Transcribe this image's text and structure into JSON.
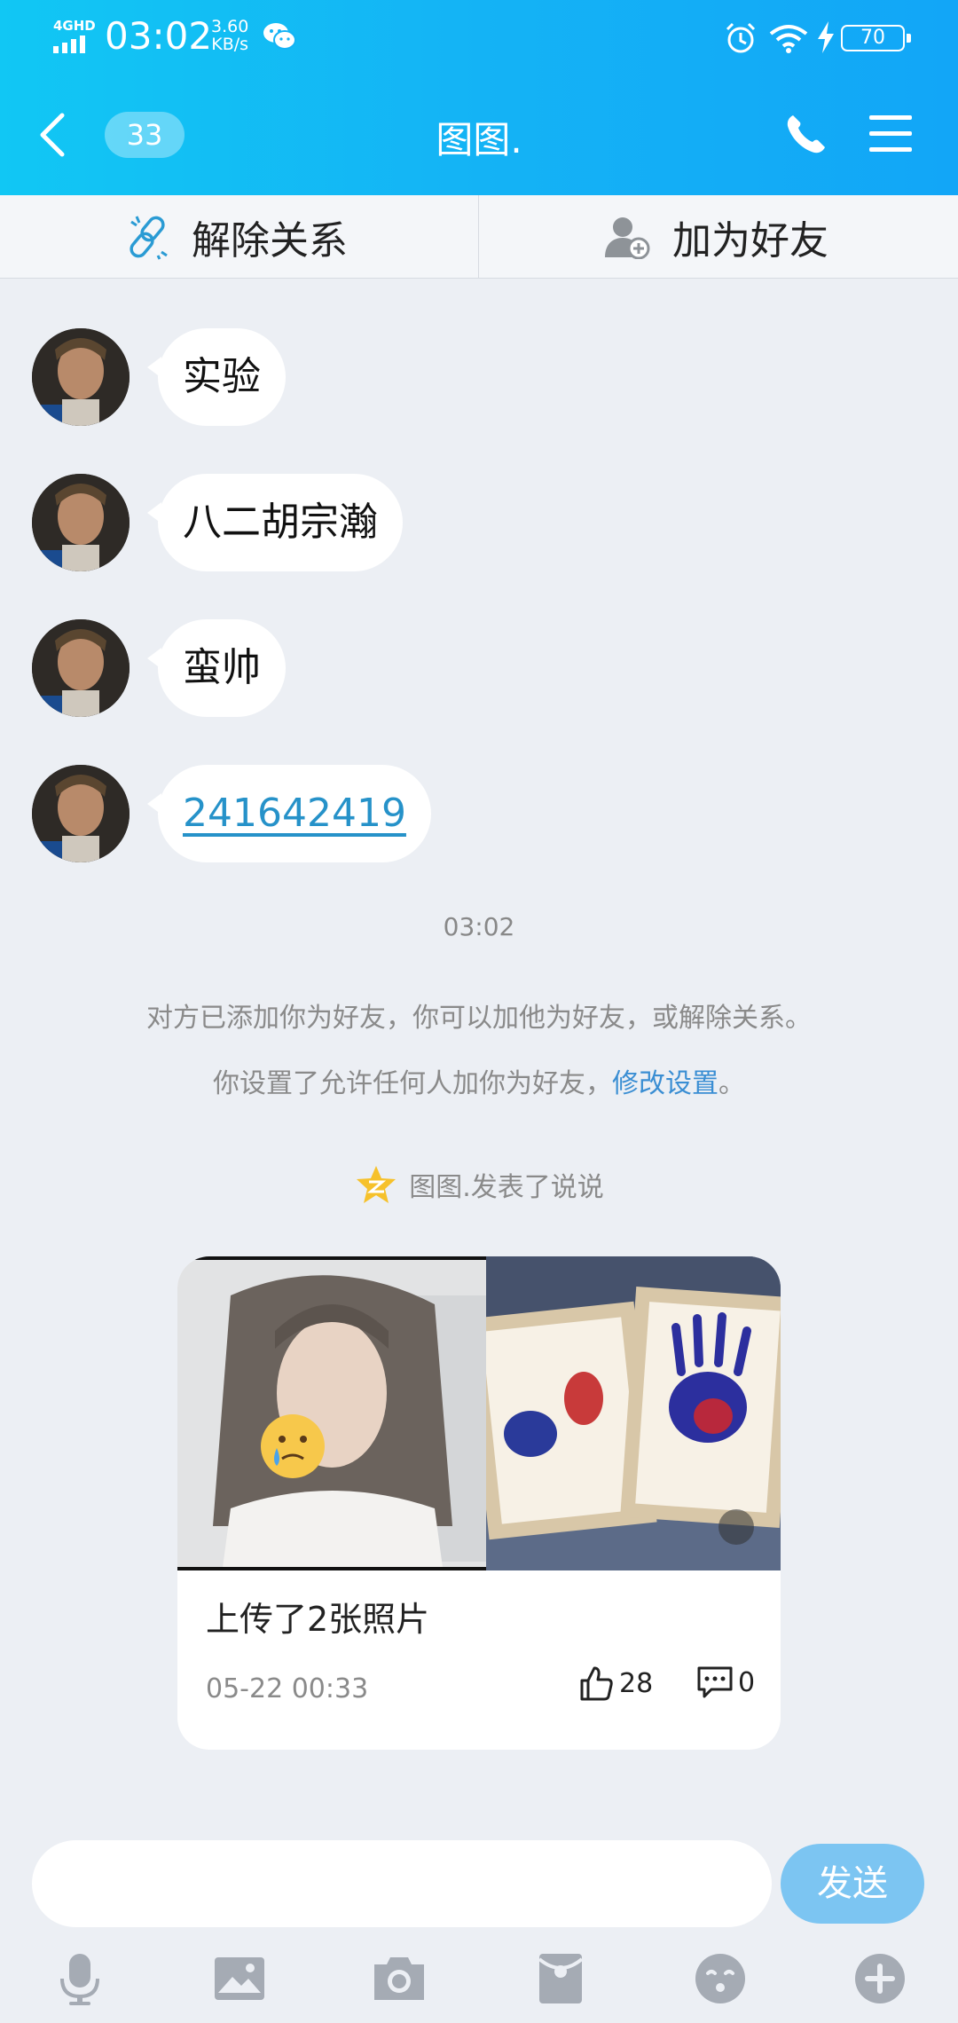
{
  "status_bar": {
    "network": "4GHD",
    "time": "03:02",
    "speed_value": "3.60",
    "speed_unit": "KB/s",
    "battery": "70"
  },
  "nav": {
    "unread_count": "33",
    "title": "图图."
  },
  "actions": {
    "unlink_label": "解除关系",
    "add_friend_label": "加为好友"
  },
  "messages": [
    {
      "text": "实验"
    },
    {
      "text": "八二胡宗瀚"
    },
    {
      "text": "蛮帅"
    },
    {
      "text": "241642419",
      "is_link": true
    }
  ],
  "system": {
    "time": "03:02",
    "note1": "对方已添加你为好友，你可以加他为好友，或解除关系。",
    "note2_prefix": "你设置了允许任何人加你为好友，",
    "note2_link": "修改设置",
    "note2_suffix": "。"
  },
  "qzone": {
    "text": "图图.发表了说说"
  },
  "card": {
    "text": "上传了2张照片",
    "date": "05-22 00:33",
    "likes": "28",
    "comments": "0"
  },
  "input": {
    "placeholder": "",
    "send_label": "发送"
  },
  "toolbar_icons": [
    "microphone-icon",
    "image-icon",
    "camera-icon",
    "red-packet-icon",
    "emoji-icon",
    "plus-icon"
  ],
  "colors": {
    "header": "#14b3f5",
    "link": "#2692c9",
    "send": "#7cc5f2",
    "background": "#eceff4"
  }
}
